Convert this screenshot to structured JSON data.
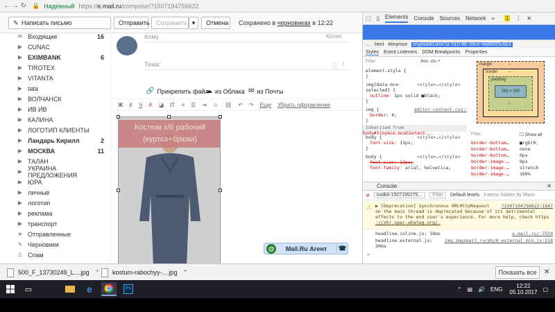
{
  "address_bar": {
    "secure_label": "Надежный",
    "url_prefix": "https://",
    "url_host": "e.mail.ru",
    "url_path": "/compose/?1507194756622"
  },
  "mail_toolbar": {
    "write_button": "Написать письмо",
    "send_button": "Отправить",
    "save_button": "Сохранить",
    "cancel_button": "Отмена",
    "saved_status_prefix": "Сохранено в ",
    "saved_status_link": "черновиках",
    "saved_status_time": " в 12:22"
  },
  "folders": [
    {
      "label": "Входящие",
      "count": "16",
      "bold": false
    },
    {
      "label": "CUNAC",
      "count": "",
      "bold": false
    },
    {
      "label": "EXIMBANK",
      "count": "6",
      "bold": true
    },
    {
      "label": "TIROTEX",
      "count": "",
      "bold": false
    },
    {
      "label": "VITANTA",
      "count": "",
      "bold": false
    },
    {
      "label": "tata",
      "count": "",
      "bold": false
    },
    {
      "label": "ВОЛЧАНСК",
      "count": "",
      "bold": false
    },
    {
      "label": "ИВ ИВ",
      "count": "",
      "bold": false
    },
    {
      "label": "КАЛИНА",
      "count": "",
      "bold": false
    },
    {
      "label": "ЛОГОТИП КЛИЕНТЫ",
      "count": "",
      "bold": false
    },
    {
      "label": "Ландарь Кирилл",
      "count": "2",
      "bold": true
    },
    {
      "label": "МОСКВА",
      "count": "11",
      "bold": true
    },
    {
      "label": "ТАЛАН",
      "count": "",
      "bold": false
    },
    {
      "label": "УКРАИНА ПРЕДЛОЖЕНИЯ",
      "count": "",
      "bold": false
    },
    {
      "label": "ЮРА",
      "count": "",
      "bold": false
    },
    {
      "label": "личные",
      "count": "",
      "bold": false
    },
    {
      "label": "логотип",
      "count": "",
      "bold": false
    },
    {
      "label": "реклама",
      "count": "",
      "bold": false
    },
    {
      "label": "транспорт",
      "count": "",
      "bold": false
    },
    {
      "label": "Отправленные",
      "count": "",
      "bold": false
    },
    {
      "label": "Черновики",
      "count": "",
      "bold": false
    },
    {
      "label": "Спам",
      "count": "",
      "bold": false
    }
  ],
  "compose": {
    "to_label": "Кому",
    "copy_label": "Копия",
    "subject_label": "Тема:",
    "attach_file": "Прикрепить файл",
    "from_cloud": "из Облака",
    "from_mail": "из Почты",
    "rte_more": "Еще",
    "rte_remove_format": "Убрать оформление",
    "image_title_line1": "Костюм х/б рабочий",
    "image_title_line2": "(куртка+брюки)",
    "agent_label": "Mail.Ru Агент"
  },
  "devtools": {
    "tabs": [
      "Elements",
      "Console",
      "Sources",
      "Network"
    ],
    "warn_count": "1",
    "breadcrumbs": [
      "html",
      "#tinymce",
      "img#iddd1d447d-7d1f-fffc-69ce-f4df9555c6b3"
    ],
    "style_tabs": [
      "Styles",
      "Event Listeners",
      "DOM Breakpoints",
      "Properties"
    ],
    "filter_label": "Filter",
    "hov_cls": ":hov  .cls  +",
    "styles": {
      "element_style": "element.style {",
      "close": "}",
      "rule1_selector": "img[data-mce-",
      "rule1_selector2": "selected] {",
      "rule1_source": "<style>…</style>",
      "rule1_prop": "outline",
      "rule1_value": "1px solid ■black;",
      "rule2_selector": "img {",
      "rule2_source": "editor-content.css:1",
      "rule2_prop": "border",
      "rule2_value": "0;",
      "inherited_prefix": "Inherited from",
      "inherited_from": "body#tinymce.mceContent...",
      "rule3_selector": "body {",
      "rule3_source": "<style>…</style>",
      "rule3_prop": "font-size",
      "rule3_value": "13px;",
      "rule4_selector": "body {",
      "rule4_source": "<style>…</style>",
      "rule4_prop1": "font-size: 12px;",
      "rule4_prop2": "font-family",
      "rule4_value2": "arial, helvetica,"
    },
    "box_model": {
      "margin_label": "margin",
      "border_label": "border",
      "padding_label": "padding",
      "content": "250 × 300",
      "dash": "–"
    },
    "computed": {
      "filter_label": "Filter",
      "show_all": "Show all",
      "rows": [
        {
          "prop": "border-bottom…",
          "val": "■rgb(0,"
        },
        {
          "prop": "border-bottom…",
          "val": "none"
        },
        {
          "prop": "border-bottom…",
          "val": "0px"
        },
        {
          "prop": "border-image-…",
          "val": "0px"
        },
        {
          "prop": "border-image-…",
          "val": "stretch"
        },
        {
          "prop": "border-image-…",
          "val": "100%"
        }
      ]
    },
    "console": {
      "tab_label": "Console",
      "context": "toolkit-1507195275…",
      "filter_label": "Filter",
      "levels": "Default levels",
      "hidden": "9 items hidden by filters",
      "warn_line1": "▶ [Deprecation] Synchronous XMLHttpRequest",
      "warn_link1": "?1507194756622:1847",
      "warn_line2": "on the main thread is deprecated because of its detrimental",
      "warn_line3": "effects to the end user's experience. For more help, check https",
      "warn_line4": "://xhr.spec.whatwg.org/.",
      "log1": "headline.inline.js: 18ms",
      "log1_link": "e.mail.ru/:7559",
      "log2": "headline.external.js:",
      "log2_link": "img.imgsmail.ru/ph/0.external.min.js:218",
      "log2_cont": "30ms",
      "prompt": ">"
    }
  },
  "downloads": {
    "items": [
      "500_F_13730249_L....jpg",
      "kostum-rabochyy-....jpg"
    ],
    "show_all": "Показать все"
  },
  "taskbar": {
    "lang": "ENG",
    "time": "12:22",
    "date": "05.10.2017"
  },
  "colors": {
    "devtools_accent": "#3b78e7",
    "image_title_bg": "#c97b7b",
    "taskbar_bg": "#1f1f28"
  }
}
